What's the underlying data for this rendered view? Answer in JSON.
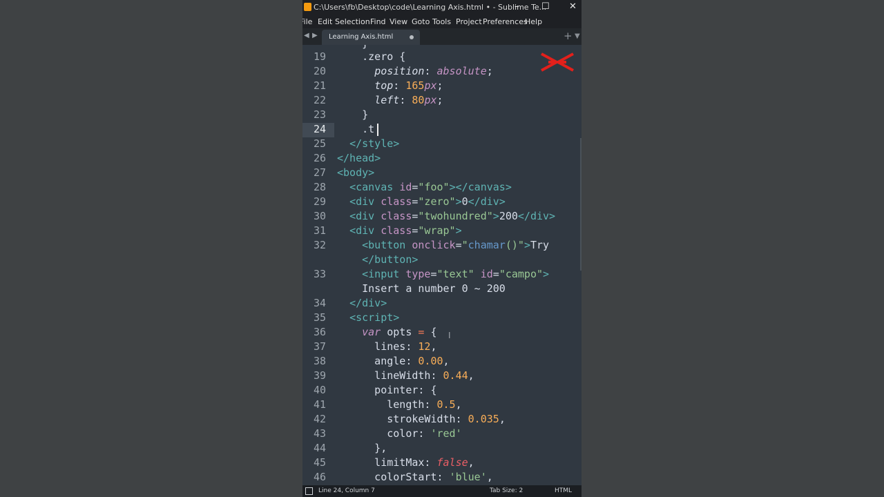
{
  "window": {
    "title": "C:\\Users\\fb\\Desktop\\code\\Learning Axis.html • - Sublime Te...",
    "controls": {
      "minimize": "–",
      "maximize": "☐",
      "close": "✕"
    }
  },
  "menu": [
    "File",
    "Edit",
    "Selection",
    "Find",
    "View",
    "Goto",
    "Tools",
    "Project",
    "Preferences",
    "Help"
  ],
  "tabs": [
    {
      "label": "Learning Axis.html",
      "dirty": true
    }
  ],
  "tabbar": {
    "nav_left": "◀",
    "nav_right": "▶",
    "new_tab": "+",
    "tab_menu": "▼"
  },
  "gutter": [
    "19",
    "20",
    "21",
    "22",
    "23",
    "24",
    "25",
    "26",
    "27",
    "28",
    "29",
    "30",
    "31",
    "32",
    "",
    "33",
    "",
    "34",
    "35",
    "36",
    "37",
    "38",
    "39",
    "40",
    "41",
    "42",
    "43",
    "44",
    "45",
    "46"
  ],
  "code": [
    "    .zero {",
    "      position: absolute;",
    "      top: 165px;",
    "      left: 80px;",
    "    }",
    "    .t",
    "  </style>",
    "</head>",
    "<body>",
    "  <canvas id=\"foo\"></canvas>",
    "  <div class=\"zero\">0</div>",
    "  <div class=\"twohundred\">200</div>",
    "  <div class=\"wrap\">",
    "    <button onclick=\"chamar()\">Try",
    "    </button>",
    "    <input type=\"text\" id=\"campo\">",
    "    Insert a number 0 ~ 200",
    "  </div>",
    "  <script>",
    "    var opts = {",
    "      lines: 12,",
    "      angle: 0.00,",
    "      lineWidth: 0.44,",
    "      pointer: {",
    "        length: 0.5,",
    "        strokeWidth: 0.035,",
    "        color: 'red'",
    "      },",
    "      limitMax: false,",
    "      colorStart: 'blue',"
  ],
  "status": {
    "position": "Line 24, Column 7",
    "tab_size": "Tab Size: 2",
    "syntax": "HTML"
  },
  "colors": {
    "tag": "#5fb4b4",
    "attr": "#c695c6",
    "string": "#99c794",
    "number": "#f9ae58",
    "function": "#6699cc",
    "keyword": "#c594c5",
    "logo": "#e3201b"
  }
}
